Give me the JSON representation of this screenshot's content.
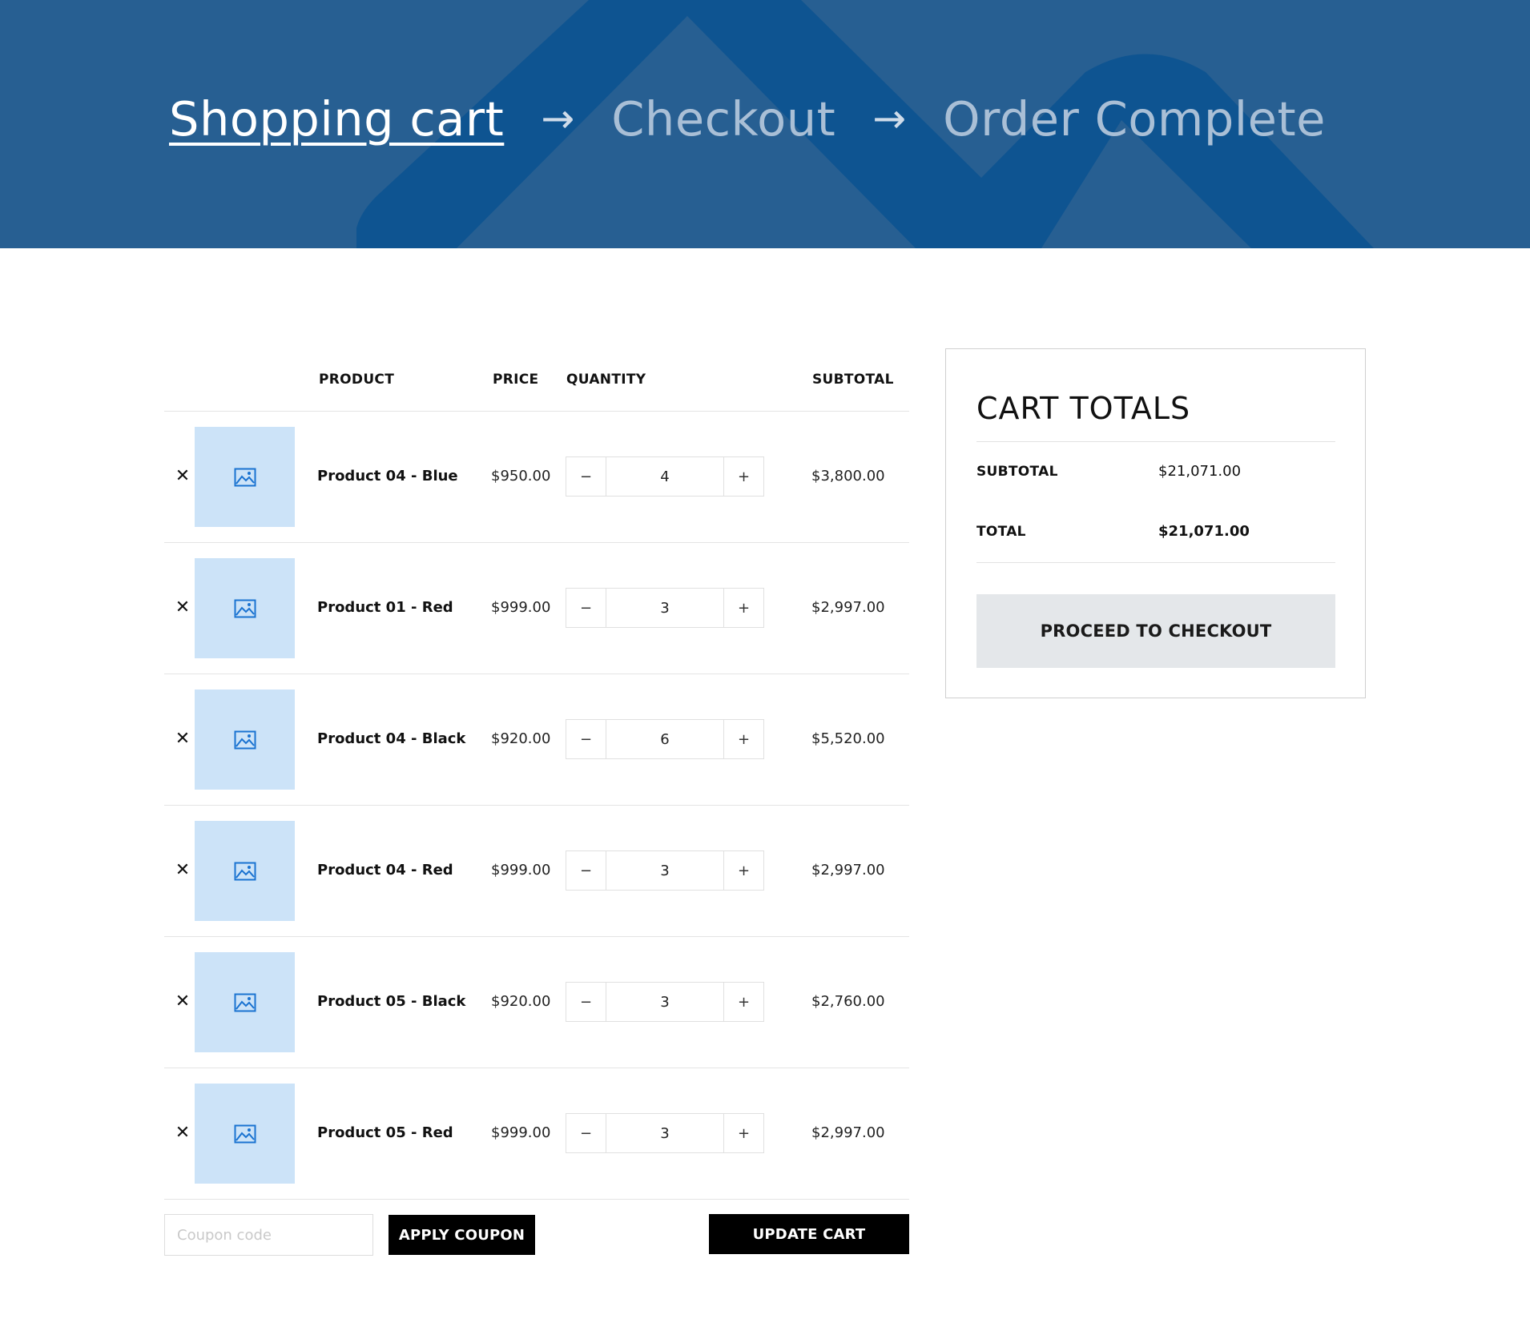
{
  "colors": {
    "hero_bg": "#275f92",
    "hero_shape": "#0e5491",
    "thumb_bg": "#cce3f8",
    "icon": "#1a73d1",
    "button": "#000000",
    "checkout_bg": "#e4e7ea"
  },
  "steps": [
    {
      "label": "Shopping cart",
      "active": true
    },
    {
      "label": "Checkout",
      "active": false
    },
    {
      "label": "Order Complete",
      "active": false
    }
  ],
  "step_arrow": "→",
  "table": {
    "headers": {
      "product": "PRODUCT",
      "price": "PRICE",
      "quantity": "QUANTITY",
      "subtotal": "SUBTOTAL"
    },
    "remove_glyph": "✕",
    "minus_glyph": "−",
    "plus_glyph": "+",
    "rows": [
      {
        "name": "Product 04 - Blue",
        "price": "$950.00",
        "qty": "4",
        "subtotal": "$3,800.00"
      },
      {
        "name": "Product 01 - Red",
        "price": "$999.00",
        "qty": "3",
        "subtotal": "$2,997.00"
      },
      {
        "name": "Product 04 - Black",
        "price": "$920.00",
        "qty": "6",
        "subtotal": "$5,520.00"
      },
      {
        "name": "Product 04 - Red",
        "price": "$999.00",
        "qty": "3",
        "subtotal": "$2,997.00"
      },
      {
        "name": "Product 05 - Black",
        "price": "$920.00",
        "qty": "3",
        "subtotal": "$2,760.00"
      },
      {
        "name": "Product 05 - Red",
        "price": "$999.00",
        "qty": "3",
        "subtotal": "$2,997.00"
      }
    ]
  },
  "actions": {
    "coupon_placeholder": "Coupon code",
    "apply_label": "APPLY COUPON",
    "update_label": "UPDATE CART"
  },
  "totals": {
    "title": "CART TOTALS",
    "subtotal_label": "SUBTOTAL",
    "subtotal_value": "$21,071.00",
    "total_label": "TOTAL",
    "total_value": "$21,071.00",
    "checkout_label": "PROCEED TO CHECKOUT"
  }
}
